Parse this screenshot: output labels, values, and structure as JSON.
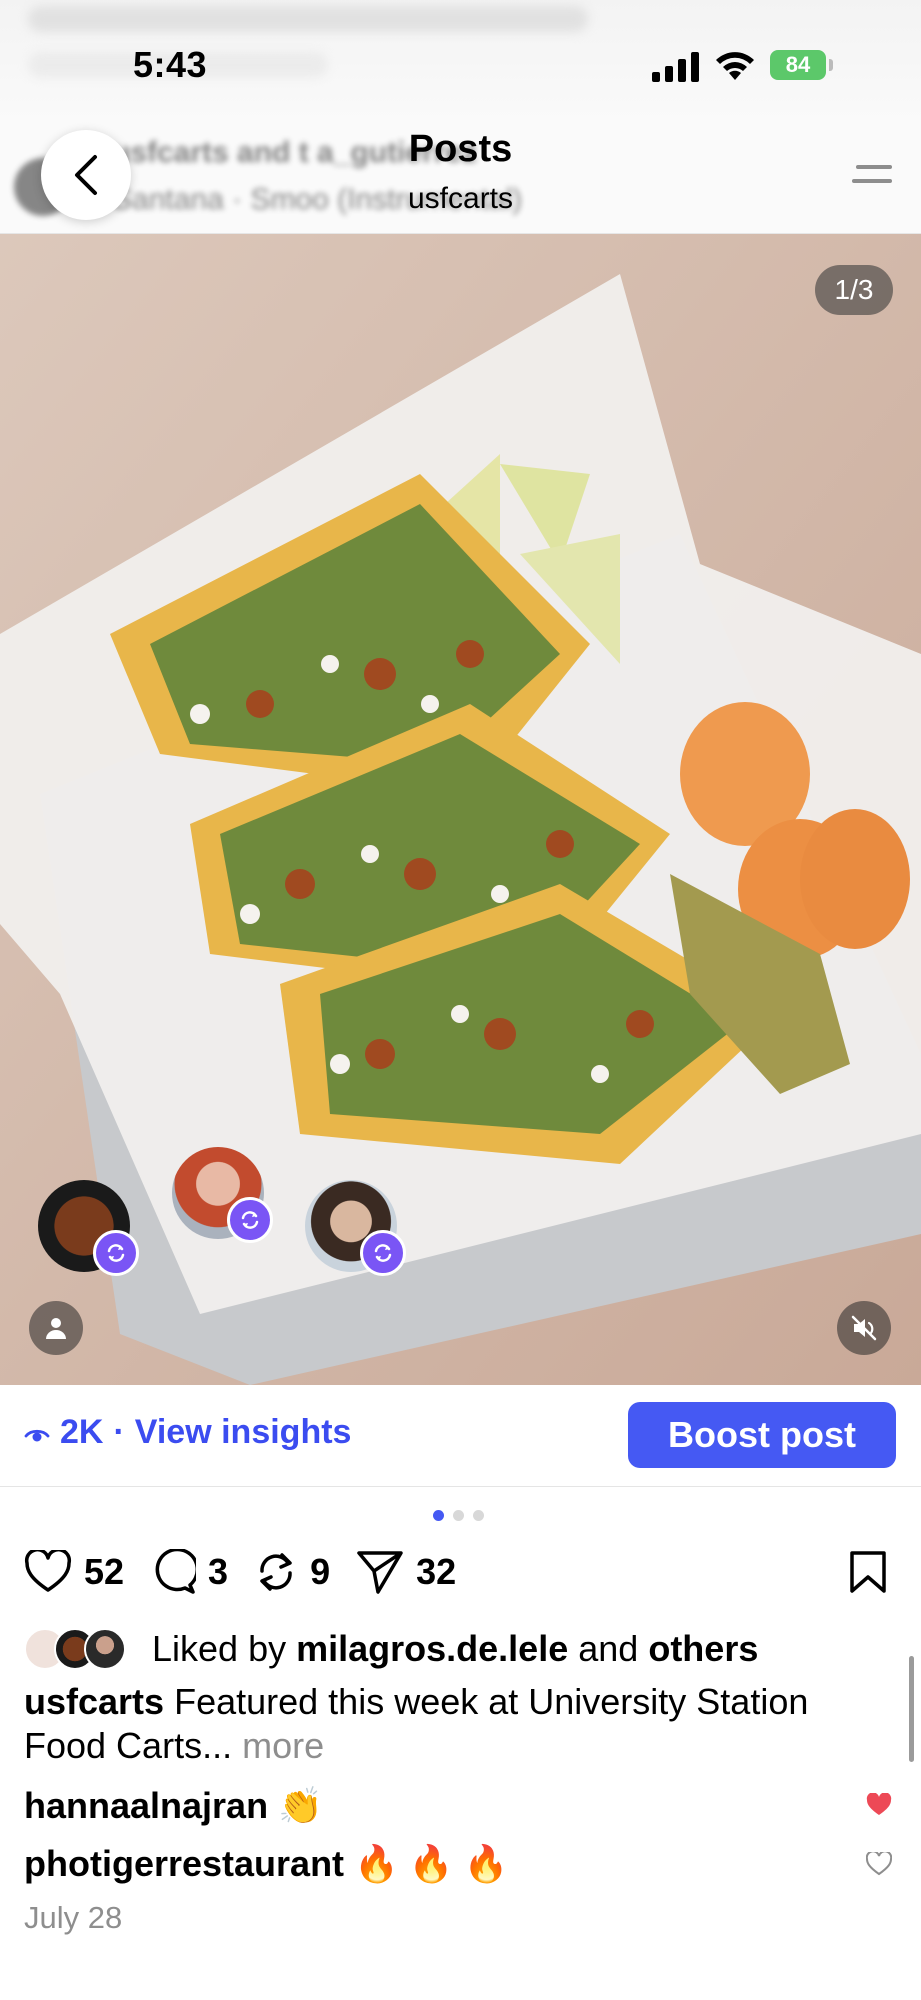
{
  "status_bar": {
    "time": "5:43",
    "battery": "84"
  },
  "header": {
    "title": "Posts",
    "subtitle": "usfcarts",
    "ghost_line_1": "usfcarts and t a_gutierrez",
    "ghost_line_2": "Santana · Smoo (Instrumental)"
  },
  "media": {
    "counter": "1/3"
  },
  "insights": {
    "views": "2K",
    "separator": "·",
    "link": "View insights",
    "boost_label": "Boost post"
  },
  "actions": {
    "likes": "52",
    "comments": "3",
    "reposts": "9",
    "shares": "32"
  },
  "liked_by": {
    "prefix": "Liked by",
    "user": "milagros.de.lele",
    "conj": "and",
    "others": "others"
  },
  "caption": {
    "username": "usfcarts",
    "text": "Featured this week at University Station Food Carts...",
    "more": "more"
  },
  "comments": [
    {
      "user": "hannaalnajran",
      "text": "👏",
      "liked": true
    },
    {
      "user": "photigerrestaurant",
      "text": "🔥 🔥 🔥",
      "liked": false
    }
  ],
  "date": "July 28",
  "colors": {
    "accent": "#4559f3",
    "like_red": "#ed4956",
    "repost_badge": "#7a55f5",
    "battery": "#5cc86a"
  }
}
